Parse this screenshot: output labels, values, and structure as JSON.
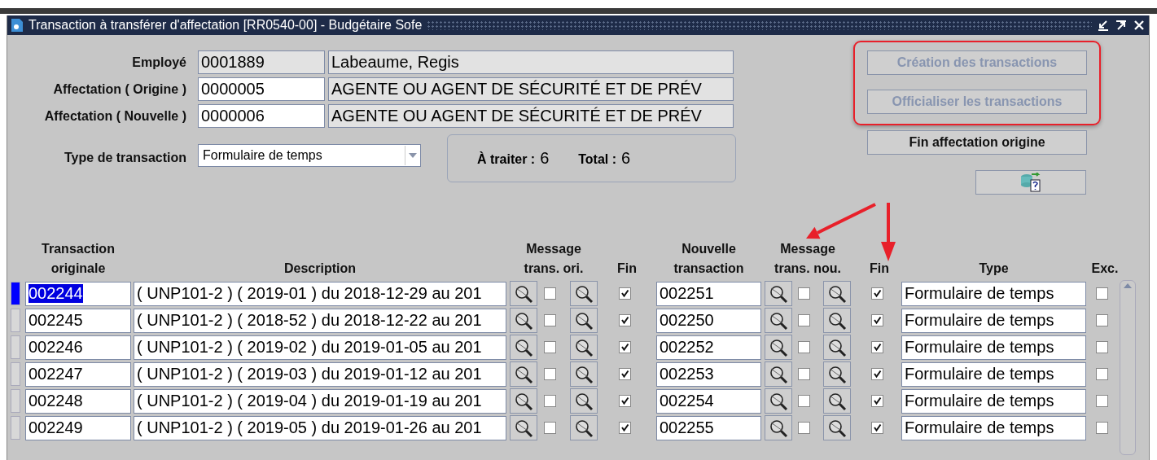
{
  "window": {
    "title": "Transaction à transférer d'affectation [RR0540-00] - Budgétaire Sofe"
  },
  "header_fields": [
    {
      "label": "Employé",
      "code": "0001889",
      "name": "Labeaume, Regis",
      "editable": false
    },
    {
      "label": "Affectation ( Origine )",
      "code": "0000005",
      "name": "AGENTE OU AGENT DE SÉCURITÉ ET DE PRÉV",
      "editable": true
    },
    {
      "label": "Affectation ( Nouvelle )",
      "code": "0000006",
      "name": "AGENTE OU AGENT DE SÉCURITÉ ET DE PRÉV",
      "editable": true
    }
  ],
  "transaction_type": {
    "label": "Type de transaction",
    "value": "Formulaire de temps"
  },
  "counters": [
    {
      "label": "À traiter :",
      "value": "6"
    },
    {
      "label": "Total :",
      "value": "6"
    }
  ],
  "highlighted_buttons": [
    {
      "label": "Création des transactions",
      "disabled": true
    },
    {
      "label": "Officialiser les transactions",
      "disabled": true
    }
  ],
  "buttons": [
    {
      "label": "Fin affectation origine",
      "disabled": false
    }
  ],
  "table": {
    "columns": [
      "Transaction originale",
      "Description",
      "Message trans. ori.",
      "Fin",
      "Nouvelle transaction",
      "Message trans. nou.",
      "Fin",
      "Type",
      "Exc."
    ],
    "rows": [
      {
        "selected": true,
        "original": "002244",
        "description": "( UNP101-2 ) ( 2019-01 ) du 2018-12-29 au 201",
        "message_ori": false,
        "fin_ori": true,
        "new": "002251",
        "message_new": false,
        "fin_new": true,
        "type": "Formulaire de temps",
        "exc": false
      },
      {
        "selected": false,
        "original": "002245",
        "description": "( UNP101-2 ) ( 2018-52 ) du 2018-12-22 au 201",
        "message_ori": false,
        "fin_ori": true,
        "new": "002250",
        "message_new": false,
        "fin_new": true,
        "type": "Formulaire de temps",
        "exc": false
      },
      {
        "selected": false,
        "original": "002246",
        "description": "( UNP101-2 ) ( 2019-02 ) du 2019-01-05 au 201",
        "message_ori": false,
        "fin_ori": true,
        "new": "002252",
        "message_new": false,
        "fin_new": true,
        "type": "Formulaire de temps",
        "exc": false
      },
      {
        "selected": false,
        "original": "002247",
        "description": "( UNP101-2 ) ( 2019-03 ) du 2019-01-12 au 201",
        "message_ori": false,
        "fin_ori": true,
        "new": "002253",
        "message_new": false,
        "fin_new": true,
        "type": "Formulaire de temps",
        "exc": false
      },
      {
        "selected": false,
        "original": "002248",
        "description": "( UNP101-2 ) ( 2019-04 ) du 2019-01-19 au 201",
        "message_ori": false,
        "fin_ori": true,
        "new": "002254",
        "message_new": false,
        "fin_new": true,
        "type": "Formulaire de temps",
        "exc": false
      },
      {
        "selected": false,
        "original": "002249",
        "description": "( UNP101-2 ) ( 2019-05 ) du 2019-01-26 au 201",
        "message_ori": false,
        "fin_ori": true,
        "new": "002255",
        "message_new": false,
        "fin_new": true,
        "type": "Formulaire de temps",
        "exc": false
      }
    ]
  }
}
